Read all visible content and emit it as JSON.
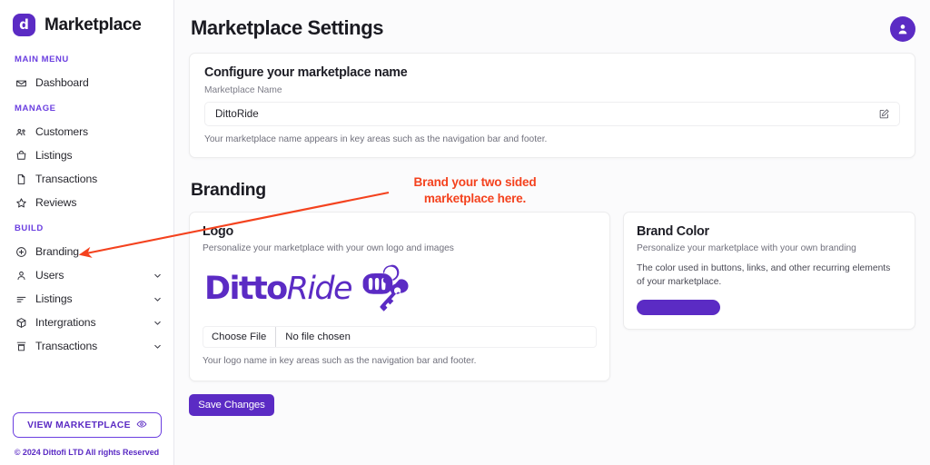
{
  "sidebar": {
    "brand": {
      "badge_letter": "d",
      "title": "Marketplace",
      "badge_color": "#5b2bc4"
    },
    "sections": [
      {
        "label": "MAIN MENU",
        "items": [
          {
            "label": "Dashboard",
            "icon": "mail-icon",
            "chevron": false
          }
        ]
      },
      {
        "label": "MANAGE",
        "items": [
          {
            "label": "Customers",
            "icon": "users-group-icon",
            "chevron": false
          },
          {
            "label": "Listings",
            "icon": "shopping-bag-icon",
            "chevron": false
          },
          {
            "label": "Transactions",
            "icon": "document-icon",
            "chevron": false
          },
          {
            "label": "Reviews",
            "icon": "star-icon",
            "chevron": false
          }
        ]
      },
      {
        "label": "BUILD",
        "items": [
          {
            "label": "Branding",
            "icon": "plus-circle-icon",
            "chevron": false
          },
          {
            "label": "Users",
            "icon": "person-icon",
            "chevron": true
          },
          {
            "label": "Listings",
            "icon": "list-lines-icon",
            "chevron": true
          },
          {
            "label": "Intergrations",
            "icon": "cube-icon",
            "chevron": true
          },
          {
            "label": "Transactions",
            "icon": "store-icon",
            "chevron": true
          }
        ]
      }
    ],
    "view_marketplace_label": "VIEW MARKETPLACE",
    "view_marketplace_icon": "eye-icon",
    "copyright": "© 2024 Dittofi LTD All rights Reserved"
  },
  "header": {
    "title": "Marketplace Settings",
    "avatar_icon": "user-avatar-icon"
  },
  "name_card": {
    "heading": "Configure your marketplace name",
    "field_label": "Marketplace Name",
    "field_value": "DittoRide",
    "field_placeholder": "Marketplace Name",
    "edit_icon": "edit-pencil-icon",
    "help_text": "Your marketplace name appears in key areas such as the navigation bar and footer."
  },
  "branding": {
    "section_heading": "Branding",
    "logo_card": {
      "heading": "Logo",
      "subtitle": "Personalize your marketplace with your own logo and images",
      "logo_text_bold": "Ditto",
      "logo_text_italic": "Ride",
      "logo_icon": "car-key-icon",
      "logo_color": "#5b2bc4",
      "choose_file_label": "Choose File",
      "file_status": "No file chosen",
      "help_text": "Your logo name in key areas such as the navigation bar and footer."
    },
    "color_card": {
      "heading": "Brand Color",
      "subtitle": "Personalize your marketplace with your own branding",
      "description": "The color used in buttons, links, and other recurring elements of your marketplace.",
      "swatch_color": "#5b2bc4"
    }
  },
  "actions": {
    "save_label": "Save Changes"
  },
  "annotation": {
    "text": "Brand your two sided marketplace here.",
    "color": "#f4421e"
  }
}
